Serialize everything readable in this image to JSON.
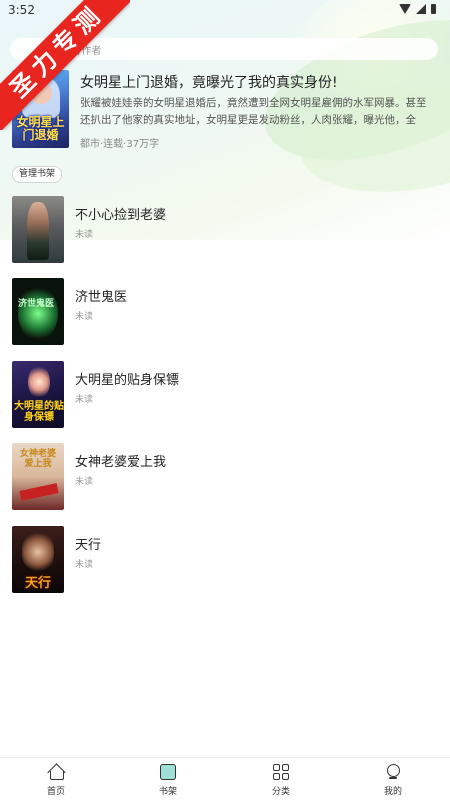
{
  "status_bar": {
    "time": "3:52"
  },
  "ribbon": {
    "text": "圣力专测"
  },
  "search": {
    "placeholder": "书名/作者"
  },
  "featured": {
    "title": "女明星上门退婚，竟曝光了我的真实身份!",
    "description": "张耀被娃娃亲的女明星退婚后，竟然遭到全网女明星雇佣的水军网暴。甚至还扒出了他家的真实地址，女明星更是发动粉丝，人肉张耀，曝光他，全网…",
    "meta": "都市·连载·37万字",
    "cover_text": "女明星上门退婚"
  },
  "manage_button": "管理书架",
  "books": [
    {
      "title": "不小心捡到老婆",
      "status": "未读"
    },
    {
      "title": "济世鬼医",
      "status": "未读",
      "cover_text": "济世鬼医"
    },
    {
      "title": "大明星的贴身保镖",
      "status": "未读",
      "cover_text": "大明星的贴身保镖"
    },
    {
      "title": "女神老婆爱上我",
      "status": "未读",
      "cover_text": "女神老婆爱上我"
    },
    {
      "title": "天行",
      "status": "未读",
      "cover_text": "天行"
    }
  ],
  "nav": [
    {
      "label": "首页",
      "icon": "home-icon"
    },
    {
      "label": "书架",
      "icon": "bookshelf-icon"
    },
    {
      "label": "分类",
      "icon": "category-grid-icon"
    },
    {
      "label": "我的",
      "icon": "profile-icon"
    }
  ]
}
